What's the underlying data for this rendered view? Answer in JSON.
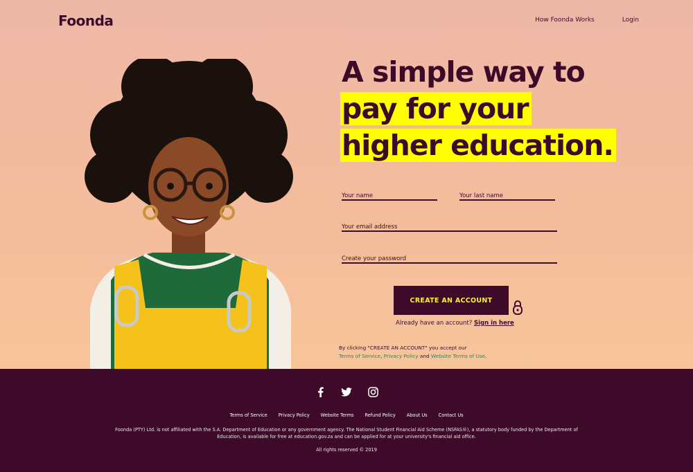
{
  "header": {
    "logo": "Foonda",
    "nav": [
      "How Foonda Works",
      "Login"
    ]
  },
  "hero": {
    "headline": [
      "A simple way to",
      "pay for your",
      "higher education."
    ]
  },
  "form": {
    "first_name_placeholder": "Your name",
    "last_name_placeholder": "Your last name",
    "email_placeholder": "Your email address",
    "password_placeholder": "Create your password",
    "submit_label": "CREATE AN ACCOUNT",
    "signin_prompt": "Already have an account?",
    "signin_link": "Sign in here",
    "terms_intro": "By clicking \"CREATE AN ACCOUNT\" you accept our",
    "terms_link": "Terms of Service",
    "terms_comma": ",",
    "privacy_link": "Privacy Policy",
    "terms_and": "and",
    "website_terms_link": "Website Terms of Use",
    "terms_end": "."
  },
  "footer": {
    "social_icons": [
      "facebook-icon",
      "twitter-icon",
      "instagram-icon"
    ],
    "links": [
      "Terms of Service",
      "Privacy Policy",
      "Website Terms",
      "Refund Policy",
      "About Us",
      "Contact Us"
    ],
    "disclaimer": "Foonda (PTY) Ltd. is not affiliated with the S.A. Department of Education or any government agency. The National Student Financial Aid Scheme (NSFAS®), a statutory body funded by the Department of Education, is available for free at education.gov.za and can be applied for at your university's financial aid office.",
    "rights": "All rights reserved © 2019"
  },
  "colors": {
    "brand": "#3d0a2a",
    "highlight": "#ffff00",
    "cta_text": "#ffef3a",
    "link_green": "#3a7f5a"
  }
}
